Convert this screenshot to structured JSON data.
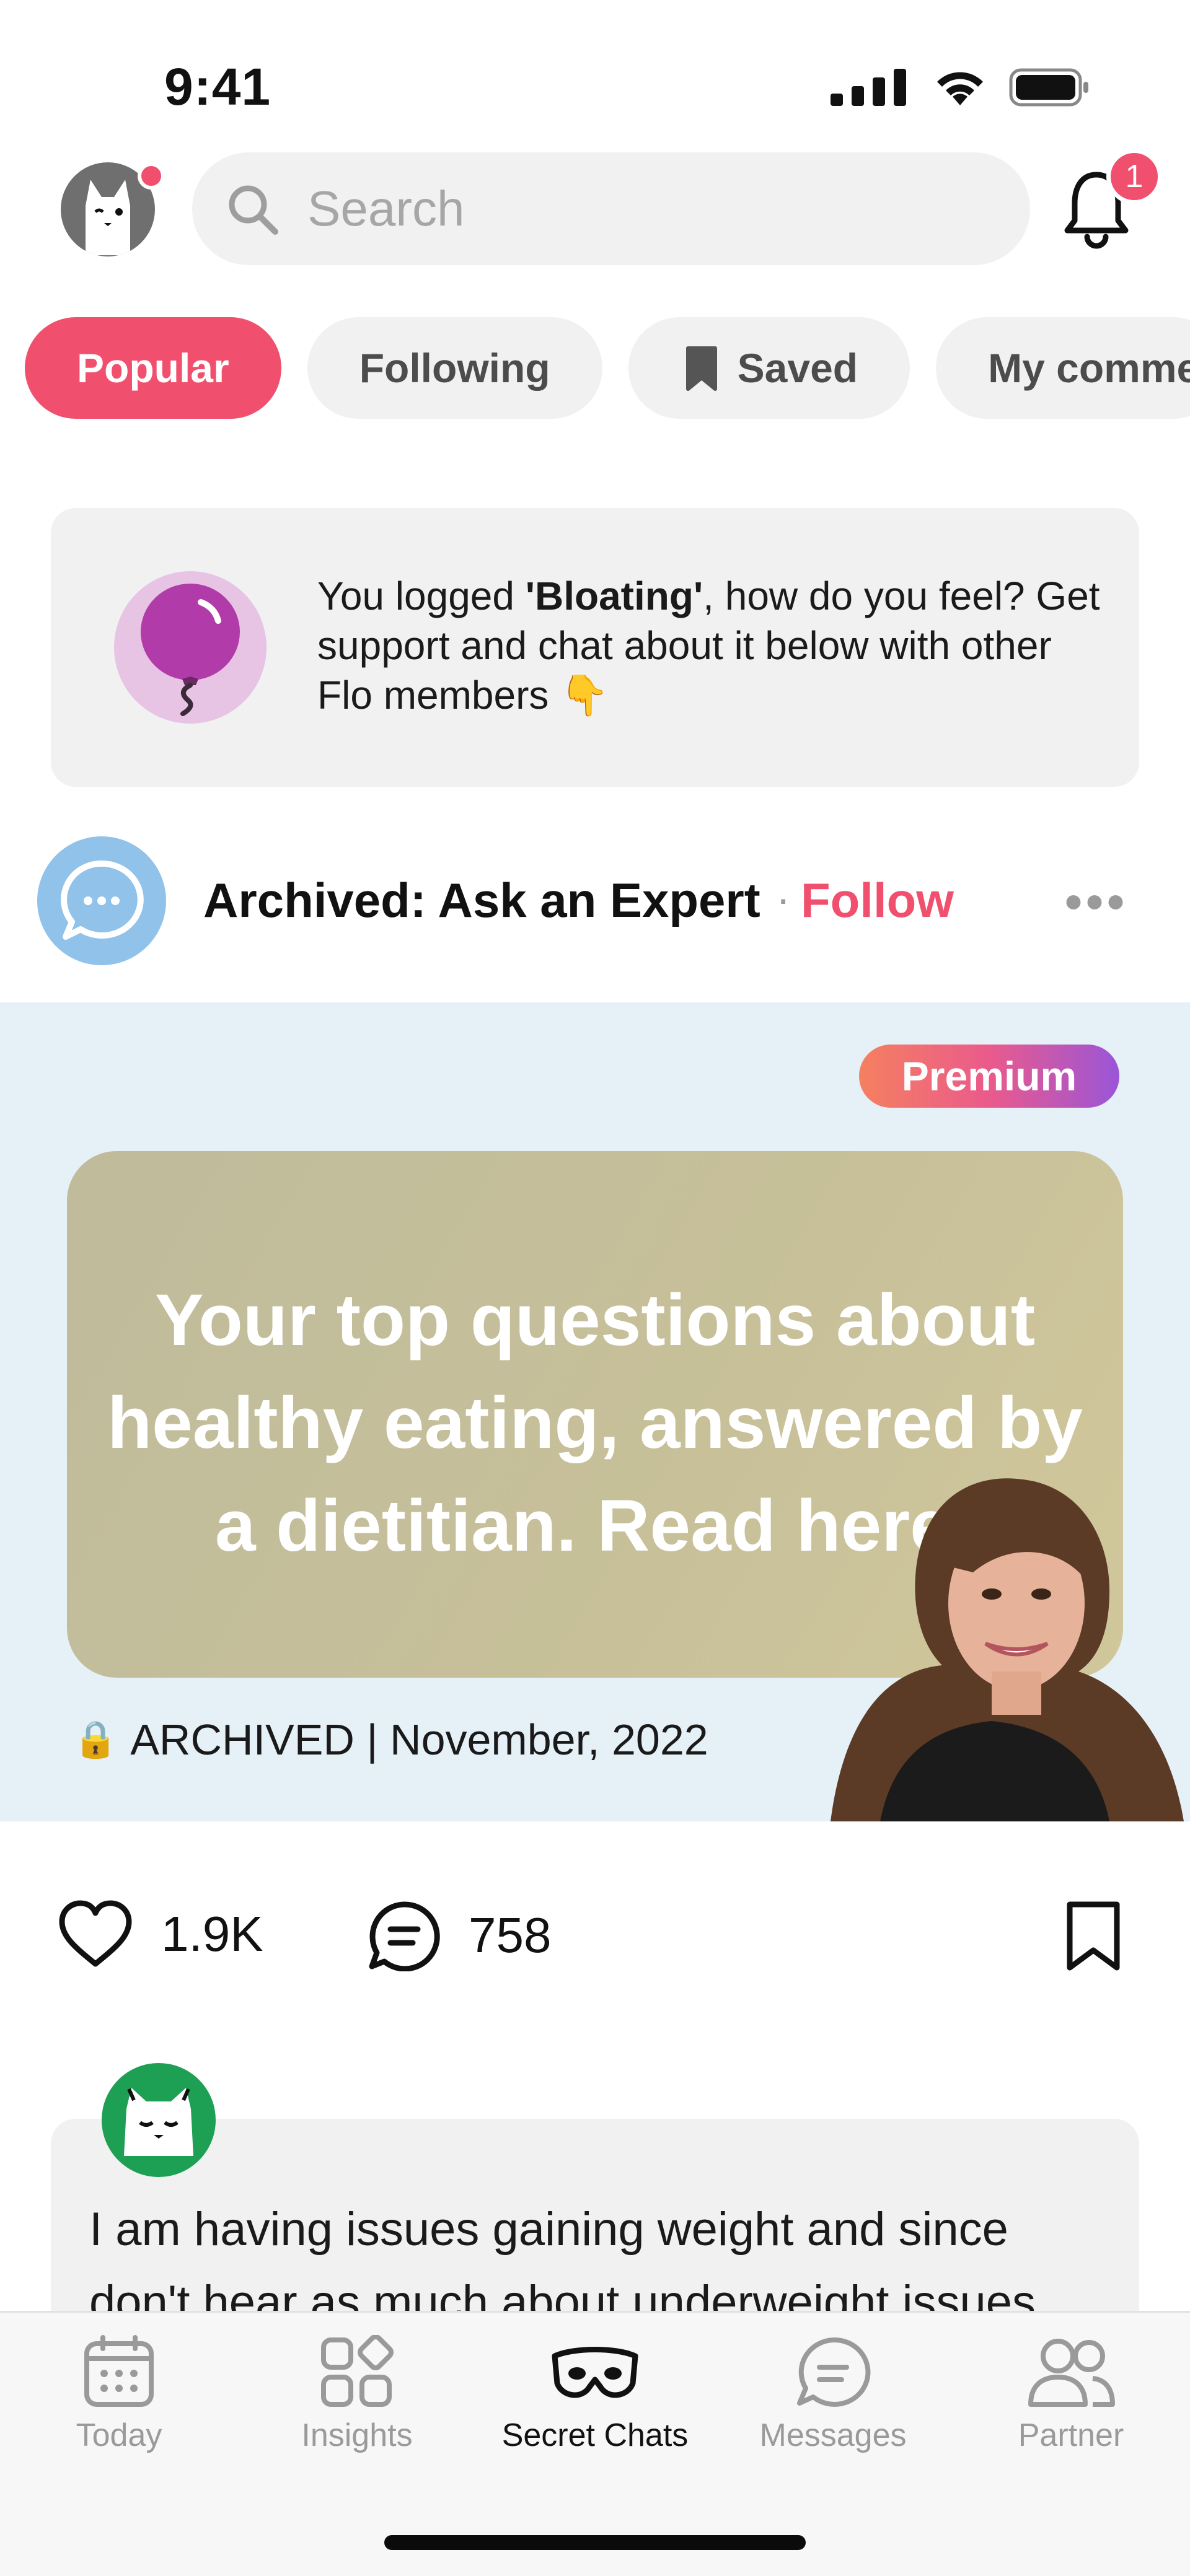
{
  "status_bar": {
    "time": "9:41"
  },
  "header": {
    "search_placeholder": "Search",
    "notification_count": "1"
  },
  "chips": [
    {
      "label": "Popular",
      "active": true
    },
    {
      "label": "Following",
      "active": false
    },
    {
      "label": "Saved",
      "active": false,
      "icon": "bookmark-icon"
    },
    {
      "label": "My comme",
      "active": false
    }
  ],
  "prompt_card": {
    "text_before": "You logged ",
    "symptom": "'Bloating'",
    "text_after": ", how do you feel? Get support and chat about it below with other Flo members",
    "emoji": "👇"
  },
  "community": {
    "name": "Archived: Ask an Expert",
    "separator": "·",
    "follow_label": "Follow",
    "more_label": "•••"
  },
  "post": {
    "badge": "Premium",
    "title": "Your top questions about healthy eating, answered by a dietitian. Read here!",
    "lock_emoji": "🔒",
    "archived_label": "ARCHIVED | November, 2022"
  },
  "reactions": {
    "likes": "1.9K",
    "comments": "758"
  },
  "comment": {
    "text": "I am having issues gaining weight and since don't hear as much about underweight issues"
  },
  "tabbar": [
    {
      "label": "Today",
      "icon": "calendar-icon",
      "active": false
    },
    {
      "label": "Insights",
      "icon": "insights-grid-icon",
      "active": false
    },
    {
      "label": "Secret Chats",
      "icon": "mask-icon",
      "active": true
    },
    {
      "label": "Messages",
      "icon": "chat-bubble-icon",
      "active": false
    },
    {
      "label": "Partner",
      "icon": "partner-icon",
      "active": false
    }
  ],
  "colors": {
    "accent": "#f0506e",
    "hero_bg": "#e6f0f7",
    "chip_bg": "#f1f1f1"
  }
}
